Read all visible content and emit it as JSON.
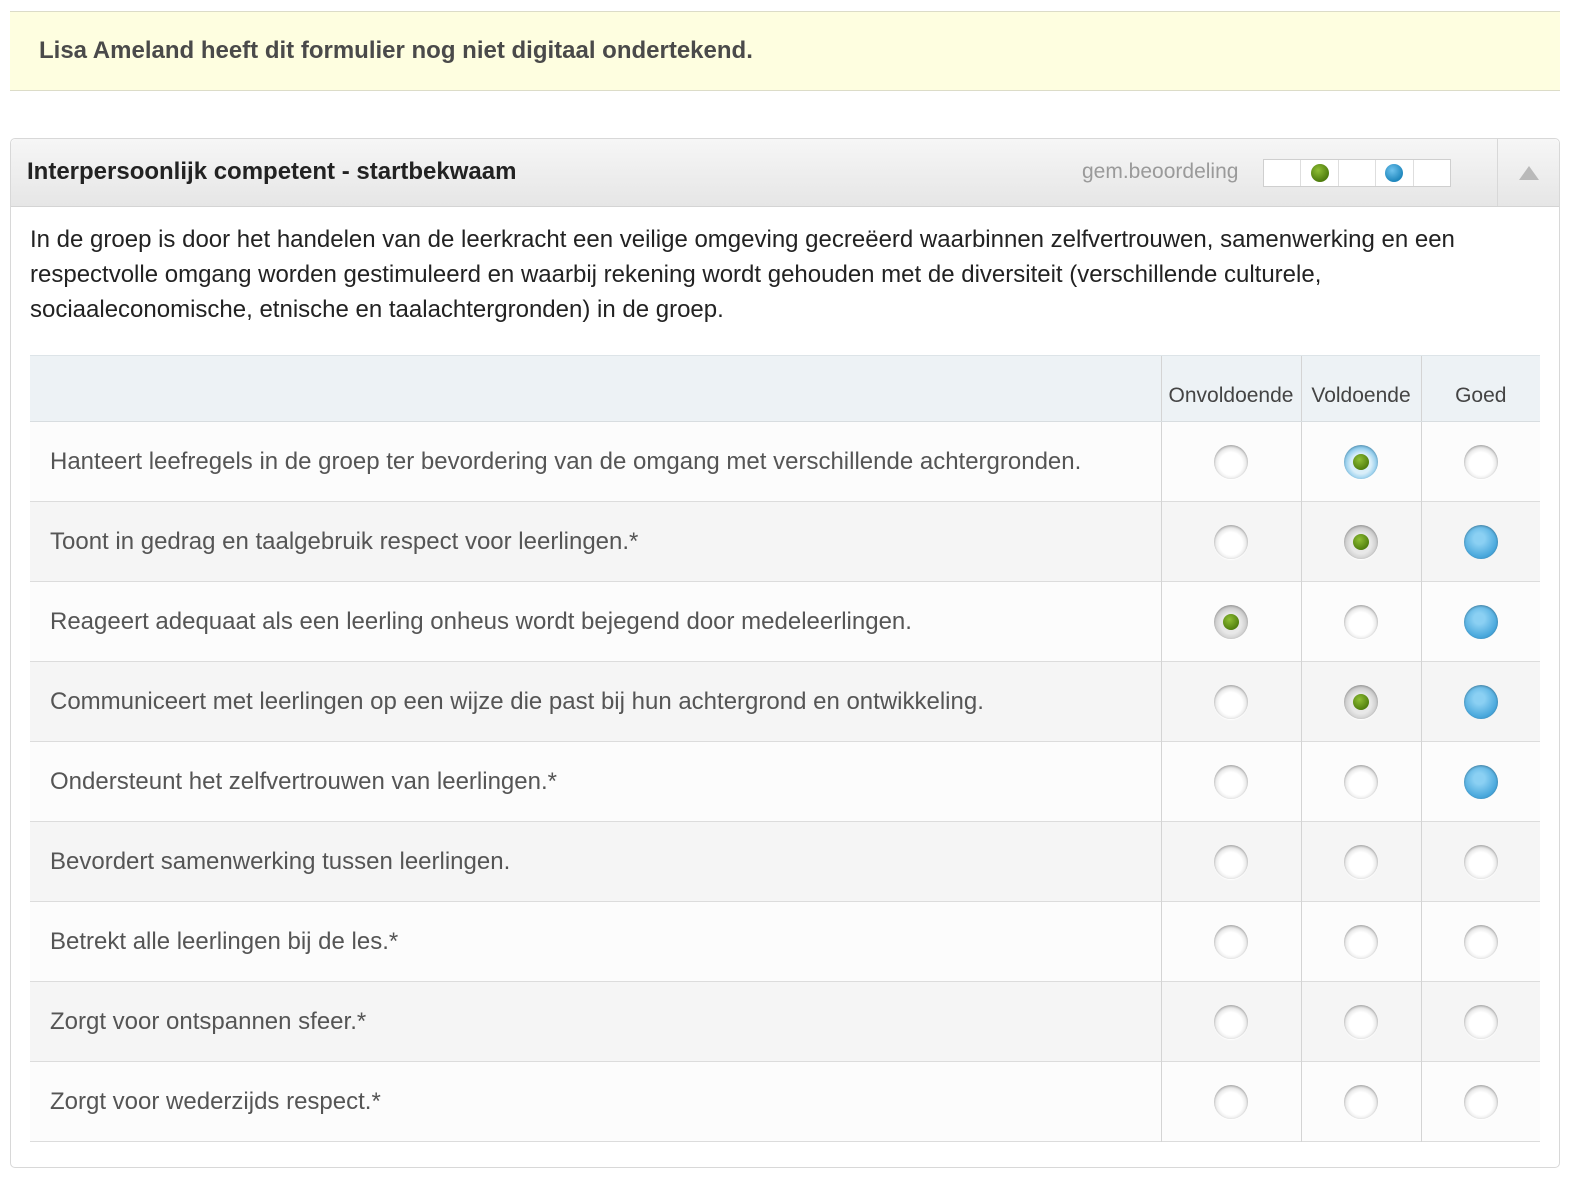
{
  "notice": {
    "text": "Lisa Ameland heeft dit formulier nog niet digitaal ondertekend."
  },
  "panel": {
    "title": "Interpersoonlijk competent - startbekwaam",
    "avg_label": "gem.beoordeling",
    "avg_scale": {
      "segments": 5,
      "markers": [
        {
          "segment": 2,
          "color": "green"
        },
        {
          "segment": 4,
          "color": "blue"
        }
      ]
    },
    "description": "In de groep is door het handelen van de leerkracht een veilige omgeving gecreëerd waarbinnen zelfvertrouwen, samenwerking en een respectvolle omgang worden gestimuleerd en waarbij rekening wordt gehouden met de diversiteit (verschillende culturele, sociaaleconomische, etnische en taalachtergronden) in de groep."
  },
  "columns": [
    "Onvoldoende",
    "Voldoende",
    "Goed"
  ],
  "colors": {
    "selected_green": "#5a8a14",
    "peer_blue": "#4aa8dc",
    "notice_bg": "#fefee0"
  },
  "rows": [
    {
      "question": "Hanteert leefregels in de groep ter bevordering van de omgang met verschillende achtergronden.",
      "states": [
        "empty",
        "selected-ring",
        "empty"
      ]
    },
    {
      "question": "Toont in gedrag en taalgebruik respect voor leerlingen.*",
      "states": [
        "empty",
        "selected",
        "blue"
      ]
    },
    {
      "question": "Reageert adequaat als een leerling onheus wordt bejegend door medeleerlingen.",
      "states": [
        "selected",
        "empty",
        "blue"
      ]
    },
    {
      "question": "Communiceert met leerlingen op een wijze die past bij hun achtergrond en ontwikkeling.",
      "states": [
        "empty",
        "selected",
        "blue"
      ]
    },
    {
      "question": "Ondersteunt het zelfvertrouwen van leerlingen.*",
      "states": [
        "empty",
        "empty",
        "blue"
      ]
    },
    {
      "question": "Bevordert samenwerking tussen leerlingen.",
      "states": [
        "empty",
        "empty",
        "empty"
      ]
    },
    {
      "question": "Betrekt alle leerlingen bij de les.*",
      "states": [
        "empty",
        "empty",
        "empty"
      ]
    },
    {
      "question": "Zorgt voor ontspannen sfeer.*",
      "states": [
        "empty",
        "empty",
        "empty"
      ]
    },
    {
      "question": "Zorgt voor wederzijds respect.*",
      "states": [
        "empty",
        "empty",
        "empty"
      ]
    }
  ]
}
